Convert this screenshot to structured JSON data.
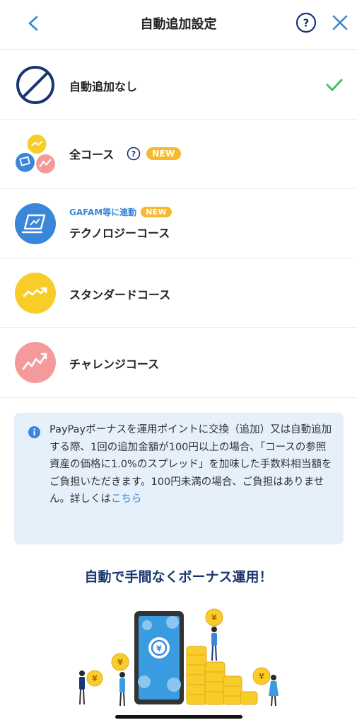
{
  "header": {
    "title": "自動追加設定"
  },
  "courses": [
    {
      "label": "自動追加なし",
      "selected": true
    },
    {
      "label": "全コース",
      "badge": "NEW",
      "has_help": true
    },
    {
      "sub_label": "GAFAM等に連動",
      "label": "テクノロジーコース",
      "badge": "NEW"
    },
    {
      "label": "スタンダードコース"
    },
    {
      "label": "チャレンジコース"
    }
  ],
  "info": {
    "text": "PayPayボーナスを運用ポイントに交換（追加）又は自動追加する際、1回の追加金額が100円以上の場合、「コースの参照資産の価格に1.0%のスプレッド」を加味した手数料相当額をご負担いただきます。100円未満の場合、ご負担はありません。詳しくは",
    "link": "こちら"
  },
  "promo": {
    "title": "自動で手間なくボーナス運用！",
    "coin_symbol": "¥"
  },
  "colors": {
    "navy": "#1a3670",
    "accent_blue": "#3a86d9",
    "check_green": "#3cc26a",
    "badge_orange": "#f5b82e",
    "standard_yellow": "#f8cd2a",
    "challenge_pink": "#f59a9a",
    "info_bg": "#e6f0fb"
  }
}
